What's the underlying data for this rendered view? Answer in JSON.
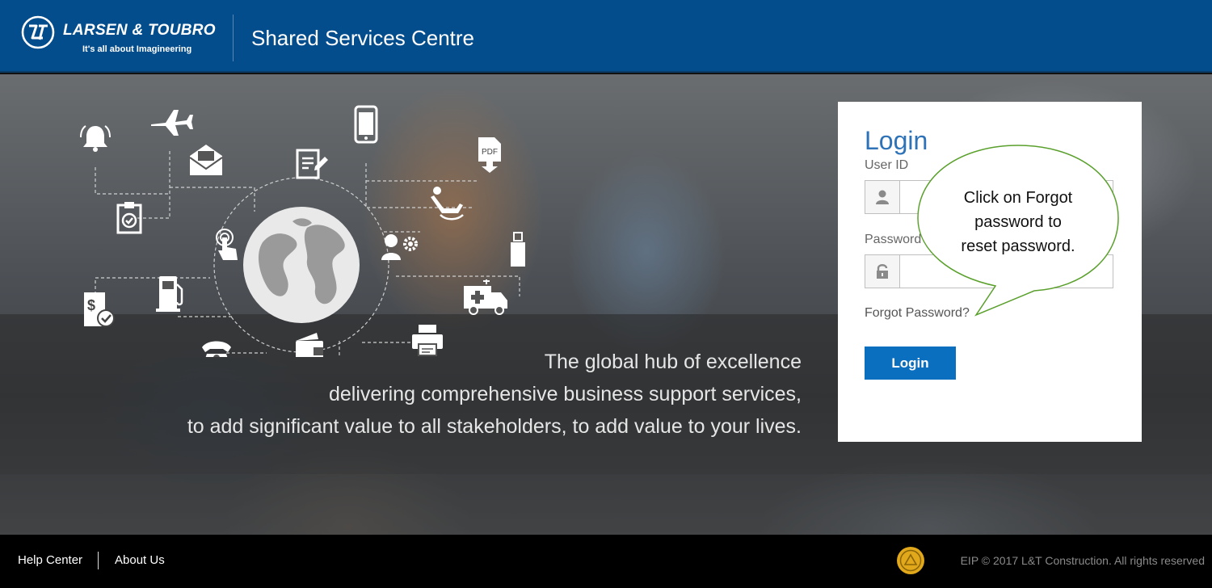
{
  "header": {
    "brand_name": "LARSEN & TOUBRO",
    "brand_tagline": "It's all about Imagineering",
    "site_title": "Shared Services Centre"
  },
  "hero": {
    "tagline_lines": [
      "The global hub of excellence",
      "delivering comprehensive business support services,",
      "to add significant value to all stakeholders, to add value to your lives."
    ],
    "infographic_icons": [
      "bell-icon",
      "airplane-icon",
      "envelope-icon",
      "smartphone-icon",
      "pdf-download-icon",
      "document-edit-icon",
      "clipboard-check-icon",
      "recliner-icon",
      "globe-icon",
      "touch-icon",
      "user-settings-icon",
      "usb-drive-icon",
      "invoice-check-icon",
      "fuel-pump-icon",
      "ambulance-icon",
      "telephone-icon",
      "wallet-icon",
      "printer-icon"
    ]
  },
  "login": {
    "title": "Login",
    "user_id_label": "User ID",
    "user_id_value": "",
    "password_label": "Password",
    "password_value": "",
    "forgot_password": "Forgot Password?",
    "login_button": "Login"
  },
  "callout": {
    "text_lines": [
      "Click on Forgot",
      "password to",
      "reset password."
    ]
  },
  "footer": {
    "help_center": "Help Center",
    "about_us": "About Us",
    "copyright": "EIP © 2017 L&T Construction. All rights reserved"
  },
  "colors": {
    "header_blue": "#044d8c",
    "login_blue": "#0b6fc0",
    "title_blue": "#2e73b8",
    "callout_green": "#5aa02c"
  }
}
